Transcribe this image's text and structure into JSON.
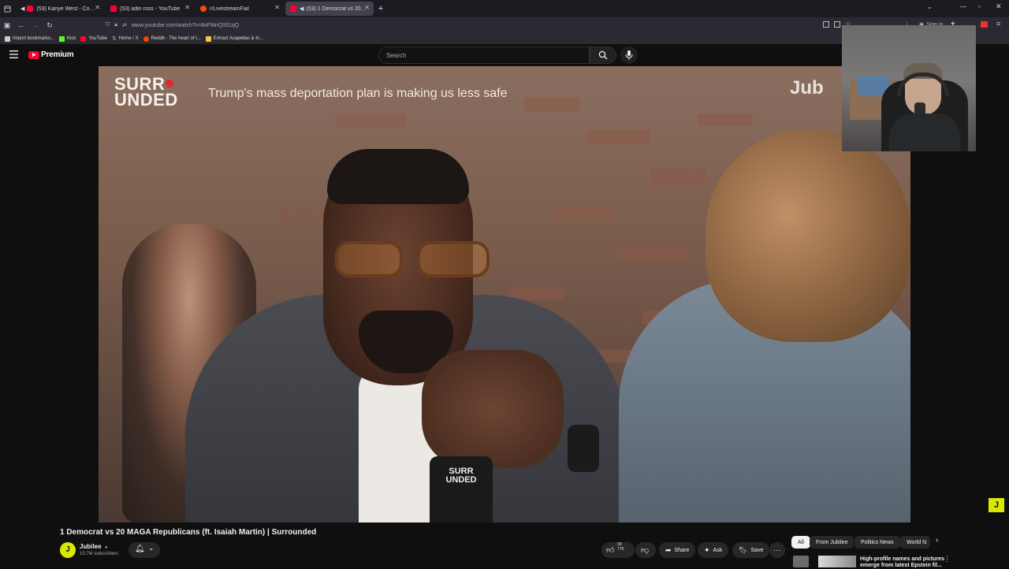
{
  "browser": {
    "tabs": [
      {
        "title": "(53) Kanye West - Come to",
        "icon": "youtube-icon",
        "audio": true
      },
      {
        "title": "(53) adin ross - YouTube",
        "icon": "youtube-icon",
        "audio": false
      },
      {
        "title": "r/LivestreamFail",
        "icon": "reddit-icon",
        "audio": false
      },
      {
        "title": "(53) 1 Democrat vs 20 MA(",
        "icon": "youtube-icon",
        "audio": true,
        "active": true
      }
    ],
    "url": "www.youtube.com/watch?v=8xFMnQ931qQ",
    "sign_in": "Sign in",
    "bookmarks": [
      {
        "label": "Import bookmarks...",
        "icon": "import-icon",
        "color": "#cccccc"
      },
      {
        "label": "Kick",
        "icon": "kick-icon",
        "color": "#53fc18"
      },
      {
        "label": "YouTube",
        "icon": "youtube-icon",
        "color": "#ff0033"
      },
      {
        "label": "Home / X",
        "icon": "x-icon",
        "color": "#ffffff"
      },
      {
        "label": "Reddit - The heart of t...",
        "icon": "reddit-icon",
        "color": "#ff4500"
      },
      {
        "label": "Extract Acapellas & In...",
        "icon": "folder-icon",
        "color": "#f6c744"
      }
    ]
  },
  "youtube": {
    "logo_label": "Premium",
    "search_placeholder": "Search",
    "video": {
      "headline": "Trump's mass deportation plan is making us less safe",
      "show_logo_line1": "SURR",
      "show_logo_line2": "UNDED",
      "watermark": "Jub",
      "mic_flag_line1": "SURR",
      "mic_flag_line2": "UNDED"
    },
    "title": "1 Democrat vs 20 MAGA Republicans (ft. Isaiah Martin) | Surrounded",
    "channel": {
      "name": "Jubilee",
      "subscribers": "10.7M subscribers",
      "avatar_letter": "J"
    },
    "actions": {
      "likes_top": "99",
      "likes_bottom": "77K",
      "share": "Share",
      "ask": "Ask",
      "save": "Save"
    },
    "chips": [
      "All",
      "From Jubilee",
      "Politics News",
      "World N"
    ],
    "related": {
      "title_line1": "High-profile names and pictures",
      "title_line2": "emerge from latest Epstein fil..."
    }
  },
  "colors": {
    "brand_red": "#ff0033",
    "jubilee_yellow": "#d8e800",
    "background": "#0f0f0f"
  }
}
